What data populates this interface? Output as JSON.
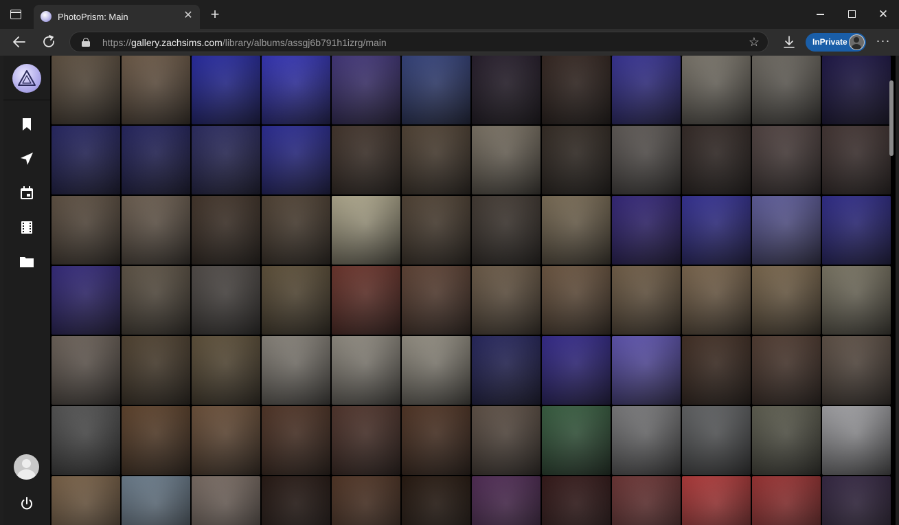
{
  "browser": {
    "tab_title": "PhotoPrism: Main",
    "tab_favicon": "photoprism-logo-icon",
    "url_prefix": "https://",
    "url_host": "gallery.zachsims.com",
    "url_path": "/library/albums/assgj6b791h1izrg/main",
    "inprivate_label": "InPrivate"
  },
  "sidebar": {
    "items": [
      {
        "name": "bookmark-icon"
      },
      {
        "name": "navigation-arrow-icon"
      },
      {
        "name": "calendar-icon"
      },
      {
        "name": "film-icon"
      },
      {
        "name": "folder-icon"
      }
    ]
  },
  "colors": {
    "accent_private": "#1a5ea8",
    "logo": "#b5b0ec"
  },
  "photos": [
    [
      "#6a5a48",
      "#7b6550",
      "#2b2fb8",
      "#3a3ad0",
      "#4a3c8a",
      "#3a4a8c",
      "#2a2030",
      "#3a2a24",
      "#3d38a8",
      "#8a8478",
      "#7a756c",
      "#201850"
    ],
    [
      "#2a2a70",
      "#28286c",
      "#30306e",
      "#2f30a8",
      "#4a3a30",
      "#5a4a3a",
      "#8a8070",
      "#3a3028",
      "#6a6460",
      "#3a2e2a",
      "#5a4a48",
      "#4a3a38"
    ],
    [
      "#6a5a4a",
      "#7a6a5a",
      "#4a3a2e",
      "#5a4a3a",
      "#c8c0a0",
      "#5a4a3a",
      "#4a4038",
      "#8a7a60",
      "#3a2a8a",
      "#3a36a8",
      "#6a68b0",
      "#34309c"
    ],
    [
      "#3a2e8c",
      "#6a5e4e",
      "#5a5450",
      "#6a5a40",
      "#7a3a30",
      "#6a4a3a",
      "#7a6650",
      "#7a6048",
      "#806a50",
      "#8a7256",
      "#8a7456",
      "#8a8470"
    ],
    [
      "#7a6e64",
      "#5a4a36",
      "#6a5a40",
      "#9a948a",
      "#a49e92",
      "#a8a294",
      "#2a2a6a",
      "#3a2e9e",
      "#6a5ec8",
      "#4a3428",
      "#5a4236",
      "#6a5a4e"
    ],
    [
      "#5e5e5e",
      "#6a4a30",
      "#7a5a40",
      "#5a3a2a",
      "#5a3a30",
      "#5a3a28",
      "#6a5a4e",
      "#3e6a48",
      "#8a8a8c",
      "#6c6e70",
      "#6a6a5a",
      "#b8b8bc"
    ],
    [
      "#8a6e50",
      "#7a8ea0",
      "#8a7a70",
      "#2a1a14",
      "#5a3a28",
      "#2a1a10",
      "#5a3060",
      "#3a1a1a",
      "#7a3a3a",
      "#c84040",
      "#b03838",
      "#3a2a4a"
    ]
  ]
}
